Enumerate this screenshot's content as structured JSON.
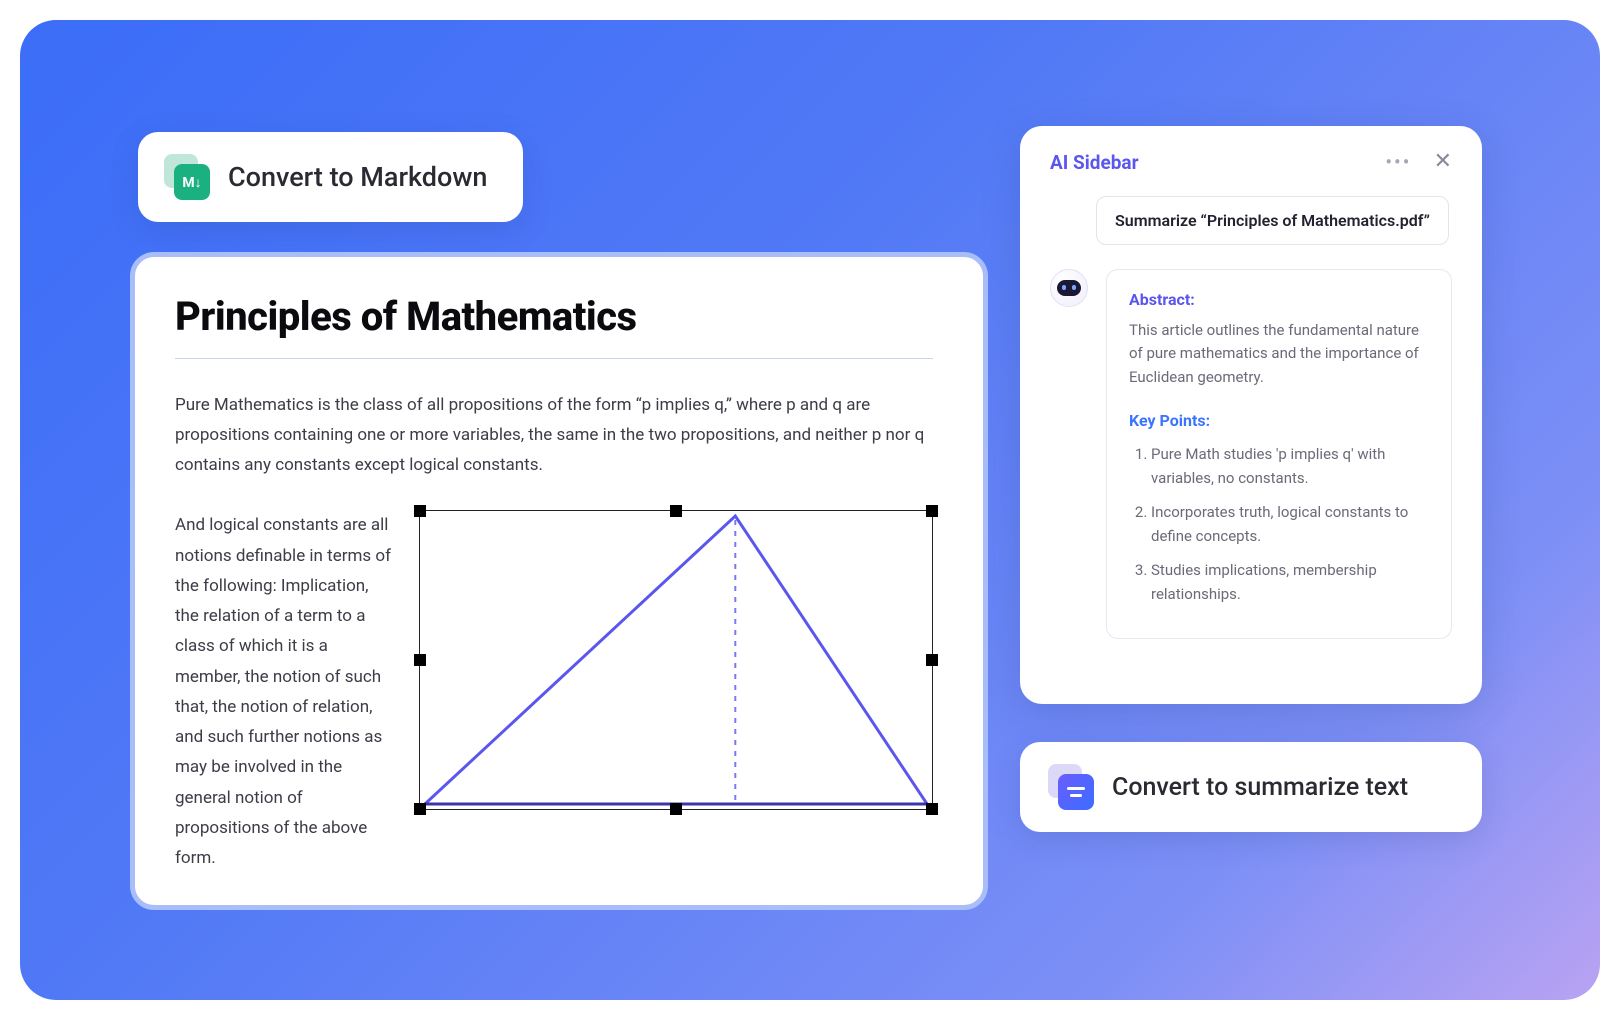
{
  "markdown_pill": {
    "icon_text": "M↓",
    "label": "Convert to Markdown"
  },
  "document": {
    "title": "Principles of Mathematics",
    "paragraph1": "Pure Mathematics is the class of all propositions of the form “p implies q,” where p and q are propositions containing one or more variables, the same in the two propositions, and neither p nor q contains any constants except logical constants.",
    "paragraph2": "And logical constants are all notions definable in terms of the following: Implication, the relation of a term to a class of which it is a member, the notion of such that, the notion of relation, and such further notions as may be involved in the general notion of propositions of the above form."
  },
  "ai_sidebar": {
    "title": "AI Sidebar",
    "prompt": "Summarize  “Principles of Mathematics.pdf”",
    "abstract_heading": "Abstract:",
    "abstract_text": "This article outlines the fundamental nature of pure mathematics and the importance of Euclidean geometry.",
    "keypoints_heading": "Key Points:",
    "keypoints": [
      "Pure Math studies 'p implies q' with variables, no constants.",
      "Incorporates truth, logical constants to define concepts.",
      "Studies implications, membership relationships."
    ]
  },
  "summarize_pill": {
    "label": "Convert to summarize text"
  }
}
